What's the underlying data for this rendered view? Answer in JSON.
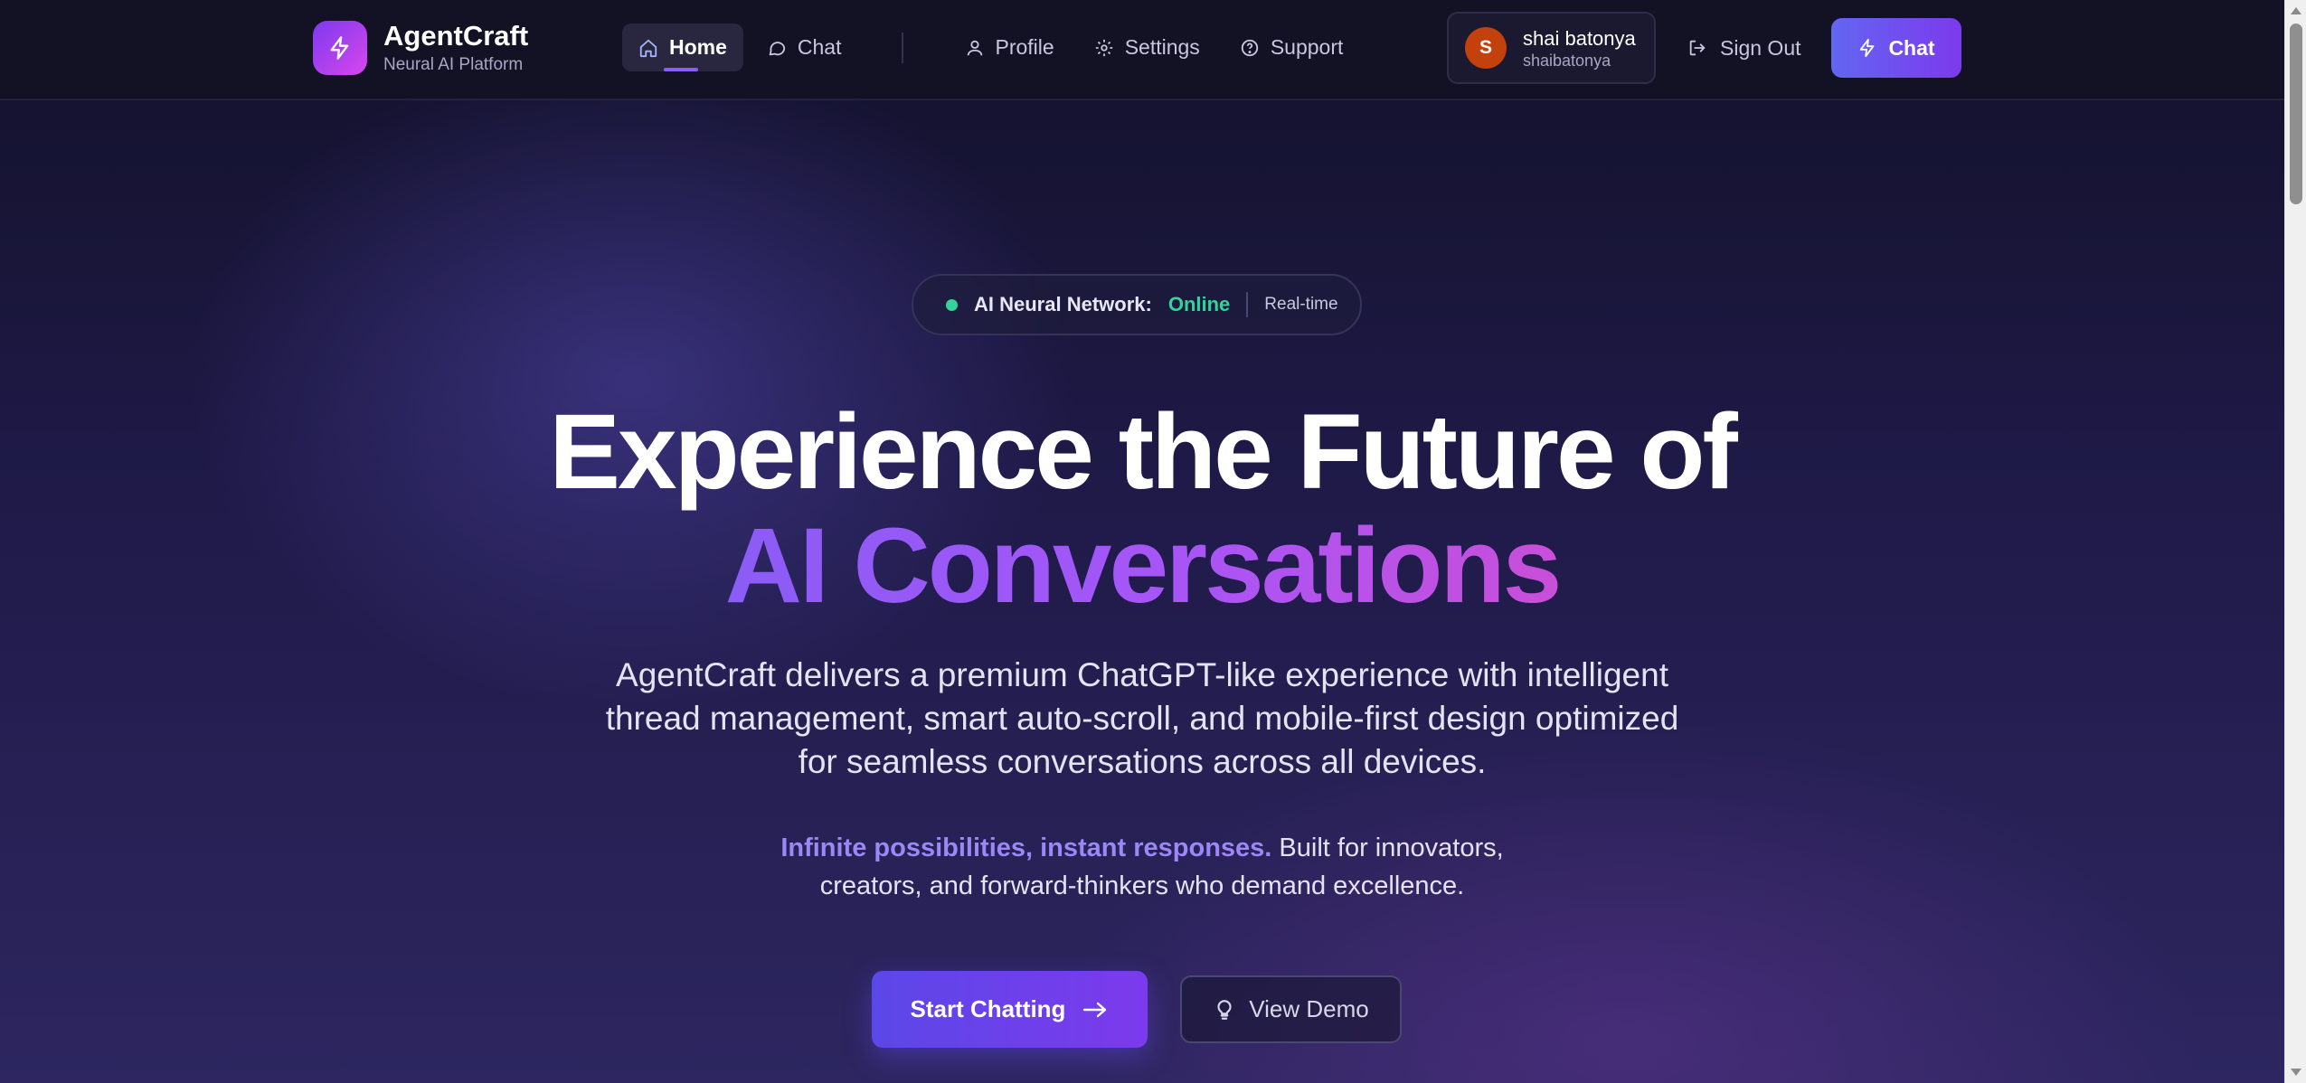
{
  "brand": {
    "name": "AgentCraft",
    "subtitle": "Neural AI Platform",
    "logo_icon": "bolt-icon"
  },
  "nav": {
    "items": [
      {
        "label": "Home",
        "icon": "home-icon",
        "active": true
      },
      {
        "label": "Chat",
        "icon": "chat-bubble-icon",
        "active": false
      },
      {
        "label": "Profile",
        "icon": "user-icon",
        "active": false
      },
      {
        "label": "Settings",
        "icon": "gear-icon",
        "active": false
      },
      {
        "label": "Support",
        "icon": "help-circle-icon",
        "active": false
      }
    ]
  },
  "user": {
    "initial": "S",
    "name": "shai batonya",
    "handle": "shaibatonya"
  },
  "sign_out_label": "Sign Out",
  "chat_button_label": "Chat",
  "status": {
    "label": "AI Neural Network:",
    "value": "Online",
    "mode": "Real-time"
  },
  "hero": {
    "line1": "Experience the Future of",
    "line2": "AI Conversations",
    "lead": "AgentCraft delivers a premium ChatGPT-like experience with intelligent thread management, smart auto-scroll, and mobile-first design optimized for seamless conversations across all devices.",
    "sub_highlight": "Infinite possibilities, instant responses.",
    "sub_rest": " Built for innovators, creators, and forward-thinkers who demand excellence."
  },
  "cta": {
    "primary": "Start Chatting",
    "secondary": "View Demo"
  },
  "colors": {
    "accent": "#7c3aed",
    "online": "#34d399",
    "highlight": "#9b87f5",
    "avatar": "#c2410c"
  }
}
